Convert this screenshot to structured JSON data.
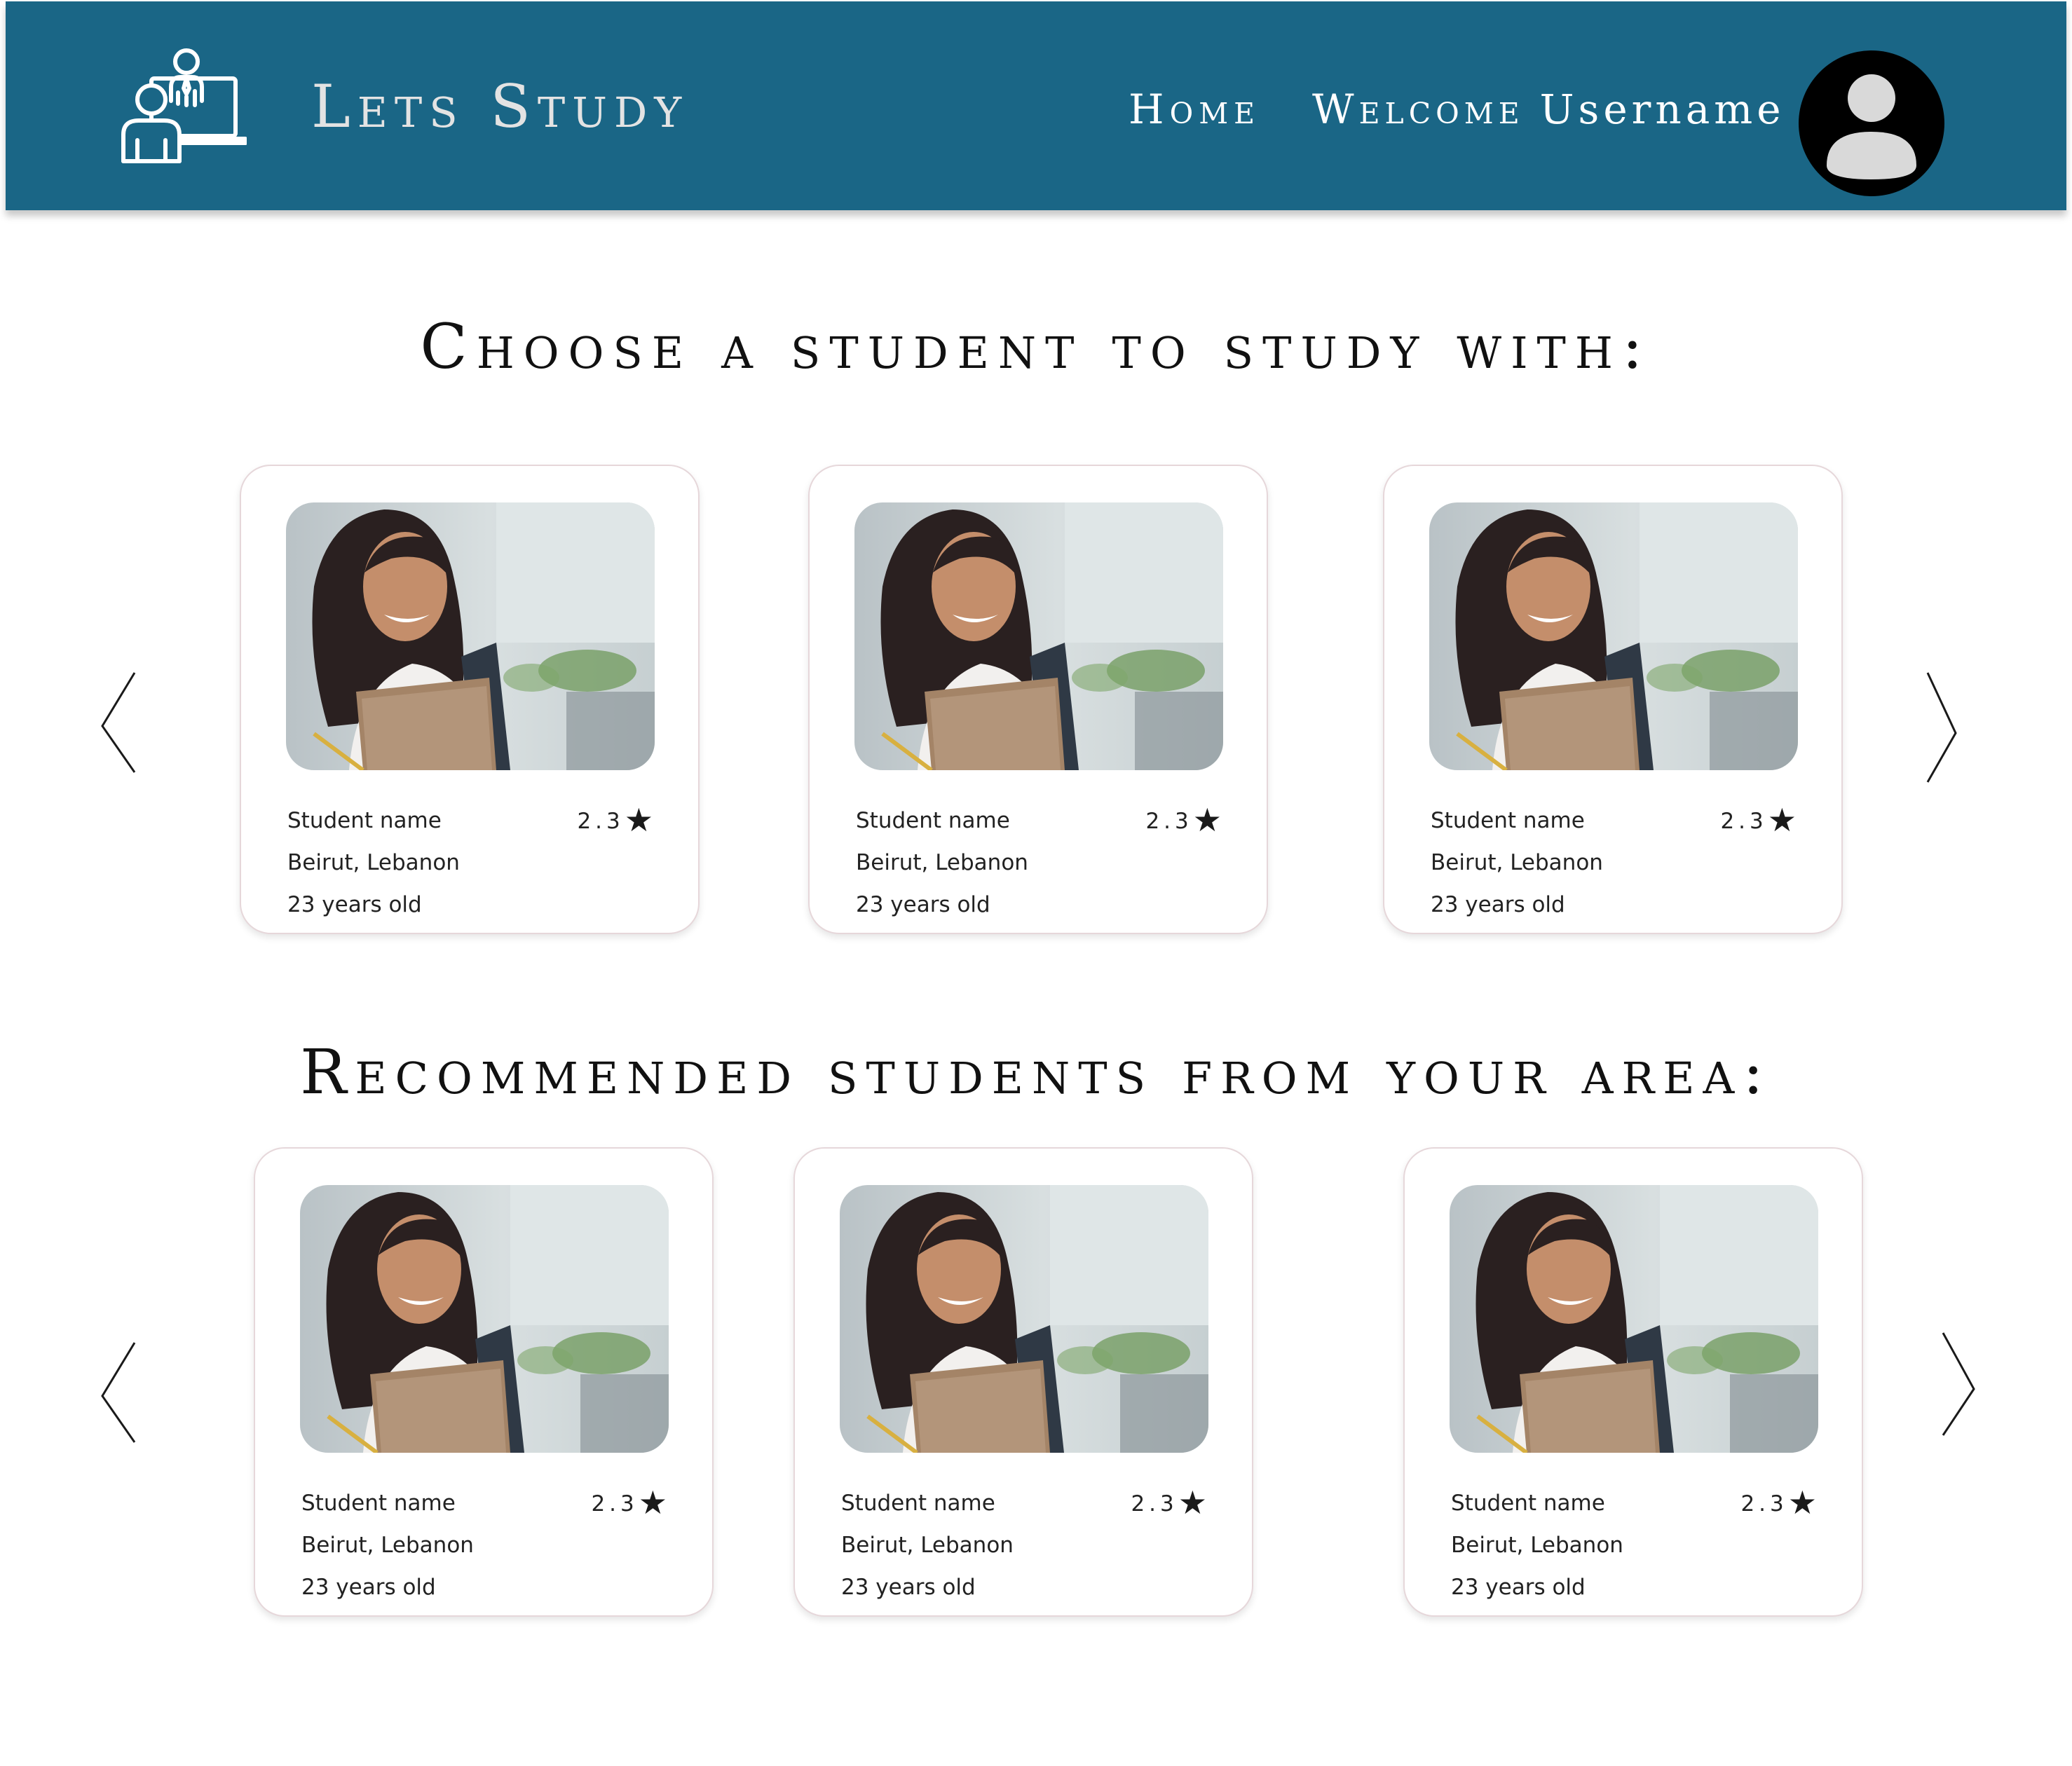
{
  "header": {
    "brand": "Lets Study",
    "nav_home": "Home",
    "welcome_label": "Welcome",
    "username": "Username",
    "logo_icon": "teacher-student-laptop-icon",
    "avatar_icon": "user-avatar-icon",
    "background_color": "#1a6686"
  },
  "sections": {
    "choose_title": "Choose a student to study with:",
    "recommended_title": "Recommended students from your area:"
  },
  "choose_cards": [
    {
      "name": "Student name",
      "rating": "2.3",
      "location": "Beirut, Lebanon",
      "age": "23 years old"
    },
    {
      "name": "Student name",
      "rating": "2.3",
      "location": "Beirut, Lebanon",
      "age": "23 years old"
    },
    {
      "name": "Student name",
      "rating": "2.3",
      "location": "Beirut, Lebanon",
      "age": "23 years old"
    }
  ],
  "recommended_cards": [
    {
      "name": "Student name",
      "rating": "2.3",
      "location": "Beirut, Lebanon",
      "age": "23 years old"
    },
    {
      "name": "Student name",
      "rating": "2.3",
      "location": "Beirut, Lebanon",
      "age": "23 years old"
    },
    {
      "name": "Student name",
      "rating": "2.3",
      "location": "Beirut, Lebanon",
      "age": "23 years old"
    }
  ],
  "icons": {
    "rating_star": "star-icon",
    "prev_arrow": "chevron-left-icon",
    "next_arrow": "chevron-right-icon"
  }
}
